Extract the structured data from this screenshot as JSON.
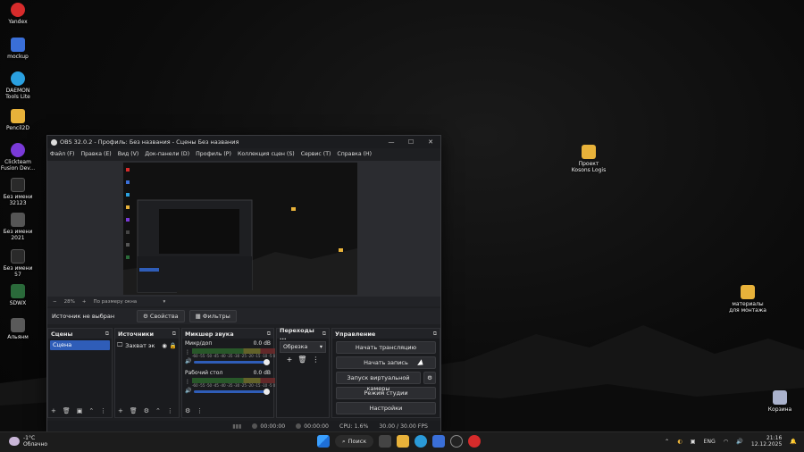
{
  "desktop": {
    "icons_left": [
      {
        "label": "Yandex",
        "color": "#d62b2b"
      },
      {
        "label": "mockup",
        "color": "#3a6fd8"
      },
      {
        "label": "DAEMON Tools Lite",
        "color": "#2aa0e0"
      },
      {
        "label": "Pencil2D",
        "color": "#e8b23a"
      },
      {
        "label": "Clickteam Fusion Dev...",
        "color": "#7a3ad8"
      },
      {
        "label": "Без имени 32123",
        "color": "#333"
      },
      {
        "label": "Без имени 2021",
        "color": "#444"
      },
      {
        "label": "Без имени 57",
        "color": "#333"
      },
      {
        "label": "SDWX",
        "color": "#2a6a3a"
      },
      {
        "label": "Альянм",
        "color": "#5a5a5a"
      }
    ],
    "icons_right": [
      {
        "label": "Проект Kosons Logis",
        "color": "#e8b23a"
      },
      {
        "label": "материалы для монтажа",
        "color": "#e8b23a"
      },
      {
        "label": "Корзина",
        "color": "#aac"
      }
    ]
  },
  "obs": {
    "title": "OBS 32.0.2 - Профиль: Без названия - Сцены Без названия",
    "window_buttons": [
      "—",
      "☐",
      "✕"
    ],
    "menu": [
      "Файл (F)",
      "Правка (E)",
      "Вид (V)",
      "Док-панели (D)",
      "Профиль (P)",
      "Коллекция сцен (S)",
      "Сервис (T)",
      "Справка (H)"
    ],
    "zoom": {
      "minus": "−",
      "value": "28%",
      "plus": "+",
      "fit": "По размеру окна",
      "arrow": "▾"
    },
    "source_bar": {
      "none_selected": "Источник не выбран",
      "properties": "Свойства",
      "filters": "Фильтры"
    },
    "scenes": {
      "header": "Сцены",
      "items": [
        "Сцена"
      ]
    },
    "sources": {
      "header": "Источники",
      "items": [
        {
          "label": "Захват эк"
        }
      ]
    },
    "mixer": {
      "header": "Микшер звука",
      "channels": [
        {
          "name": "Микр/доп",
          "db": "0.0 dB"
        },
        {
          "name": "Рабочий стол",
          "db": "0.0 dB"
        }
      ],
      "ticks": "-60 -55 -50 -45 -40 -35 -30 -25 -20 -15 -10 -5 0"
    },
    "transitions": {
      "header": "Переходы ...",
      "selected": "Обрезка"
    },
    "controls": {
      "header": "Управление",
      "buttons": [
        "Начать трансляцию",
        "Начать запись",
        "Запуск виртуальной камеры",
        "Режим студии",
        "Настройки"
      ]
    },
    "status": {
      "stream_time": "00:00:00",
      "rec_time": "00:00:00",
      "cpu": "CPU: 1.6%",
      "fps": "30.00 / 30.00 FPS"
    }
  },
  "taskbar": {
    "weather_temp": "-1°C",
    "weather_desc": "Облачно",
    "search": "Поиск",
    "lang": "ENG",
    "time": "21:16",
    "date": "12.12.2025"
  }
}
